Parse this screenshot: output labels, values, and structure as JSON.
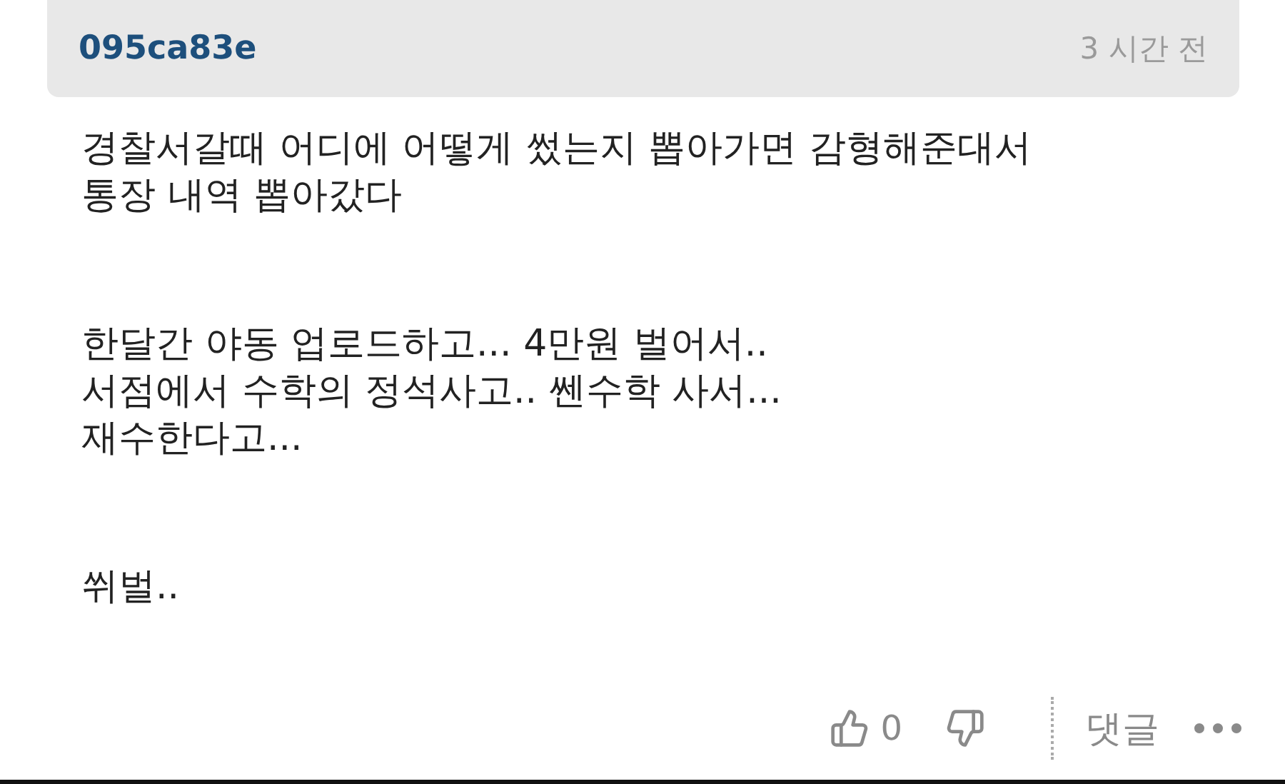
{
  "comment": {
    "author": "095ca83e",
    "time": "3 시간 전",
    "paragraphs": [
      [
        "경찰서갈때 어디에 어떻게 썼는지 뽑아가면 감형해준대서",
        "통장 내역 뽑아갔다"
      ],
      [
        "한달간 야동 업로드하고... 4만원 벌어서..",
        "서점에서 수학의 정석사고.. 쎈수학 사서...",
        "재수한다고..."
      ],
      [
        "쒸벌.."
      ]
    ],
    "like_count": "0",
    "reply_label": "댓글"
  }
}
